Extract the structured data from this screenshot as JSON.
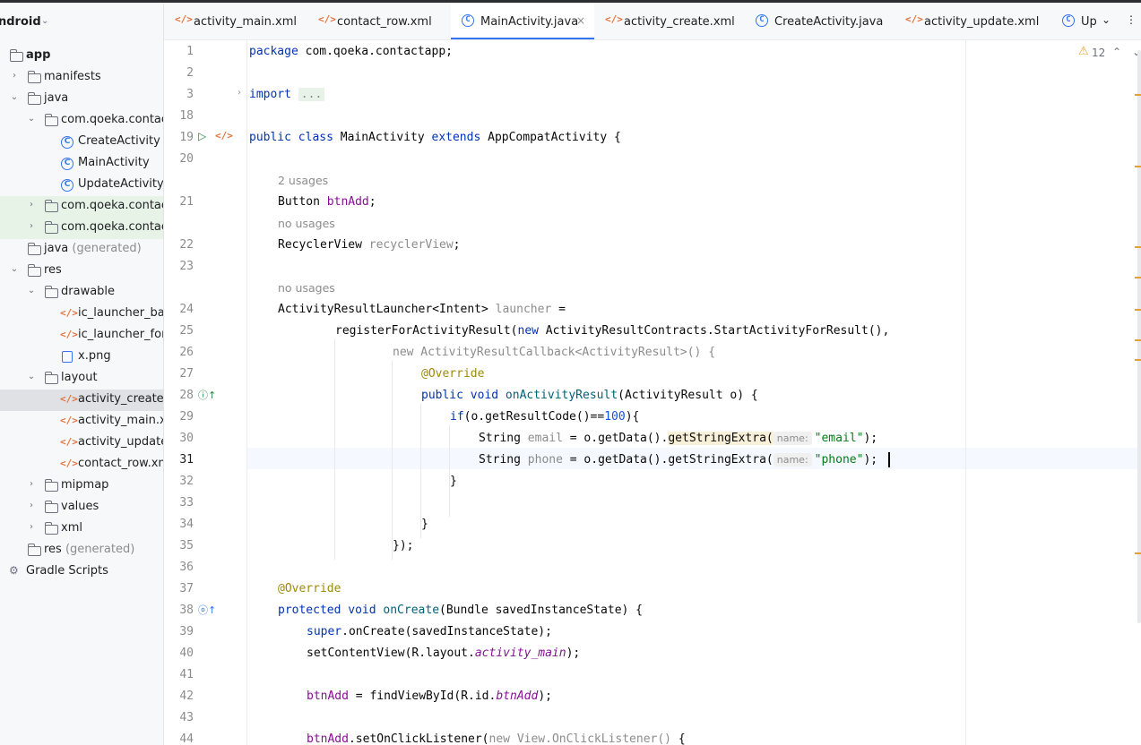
{
  "project": {
    "title": "ndroid",
    "tree": [
      {
        "label": "app",
        "bold": true,
        "icon": "folder-icon"
      },
      {
        "label": "manifests",
        "icon": "folder-icon"
      },
      {
        "label": "java",
        "icon": "folder-icon"
      },
      {
        "label": "com.qoeka.contacta",
        "icon": "package-icon"
      },
      {
        "label": "CreateActivity",
        "icon": "class-icon"
      },
      {
        "label": "MainActivity",
        "icon": "class-icon"
      },
      {
        "label": "UpdateActivity",
        "icon": "class-icon"
      },
      {
        "label": "com.qoeka.contacta",
        "icon": "package-icon"
      },
      {
        "label": "com.qoeka.contacta",
        "icon": "package-icon"
      },
      {
        "label": "java",
        "suffix": "(generated)",
        "icon": "folder-icon"
      },
      {
        "label": "res",
        "icon": "folder-icon"
      },
      {
        "label": "drawable",
        "icon": "folder-icon"
      },
      {
        "label": "ic_launcher_bacl",
        "icon": "xml-icon"
      },
      {
        "label": "ic_launcher_fore",
        "icon": "xml-icon"
      },
      {
        "label": "x.png",
        "icon": "image-icon"
      },
      {
        "label": "layout",
        "icon": "folder-icon"
      },
      {
        "label": "activity_create.xn",
        "icon": "xml-icon"
      },
      {
        "label": "activity_main.xml",
        "icon": "xml-icon"
      },
      {
        "label": "activity_update.x",
        "icon": "xml-icon"
      },
      {
        "label": "contact_row.xml",
        "icon": "xml-icon"
      },
      {
        "label": "mipmap",
        "icon": "folder-icon"
      },
      {
        "label": "values",
        "icon": "folder-icon"
      },
      {
        "label": "xml",
        "icon": "folder-icon"
      },
      {
        "label": "res",
        "suffix": "(generated)",
        "icon": "folder-icon"
      },
      {
        "label": "Gradle Scripts",
        "icon": "gradle-icon"
      }
    ]
  },
  "tabs": [
    {
      "label": "activity_main.xml",
      "icon": "xml"
    },
    {
      "label": "contact_row.xml",
      "icon": "xml"
    },
    {
      "label": "MainActivity.java",
      "icon": "class",
      "active": true
    },
    {
      "label": "activity_create.xml",
      "icon": "xml"
    },
    {
      "label": "CreateActivity.java",
      "icon": "class"
    },
    {
      "label": "activity_update.xml",
      "icon": "xml"
    },
    {
      "label": "Up",
      "icon": "class"
    }
  ],
  "inspection": {
    "warnings": "12"
  },
  "editor": {
    "current_line": "31",
    "line_numbers": [
      "1",
      "2",
      "3",
      "18",
      "19",
      "20",
      "21",
      "22",
      "23",
      "24",
      "25",
      "26",
      "27",
      "28",
      "29",
      "30",
      "31",
      "32",
      "33",
      "34",
      "35",
      "36",
      "37",
      "38",
      "39",
      "40",
      "41",
      "42",
      "43",
      "44"
    ],
    "hints": {
      "usages_2": "2 usages",
      "no_usages_a": "no usages",
      "no_usages_b": "no usages",
      "param_name": "name:"
    },
    "code": {
      "l1_kw": "package",
      "l1_rest": " com.qoeka.contactapp;",
      "l3_kw": "import",
      "l3_fold": "...",
      "l19_kw": "public class",
      "l19_name": " MainActivity ",
      "l19_ext": "extends",
      "l19_rest": " AppCompatActivity {",
      "l21_type": "Button ",
      "l21_field": "btnAdd",
      "l21_end": ";",
      "l22_type": "RecyclerView ",
      "l22_field": "recyclerView",
      "l22_end": ";",
      "l24_type": "ActivityResultLauncher<Intent> ",
      "l24_field": "launcher",
      "l24_end": " =",
      "l25_a": "registerForActivityResult(",
      "l25_new": "new",
      "l25_b": " ActivityResultContracts.StartActivityForResult(),",
      "l26": "new ActivityResultCallback<ActivityResult>() {",
      "l27": "@Override",
      "l28_kw": "public void",
      "l28_fn": " onActivityResult",
      "l28_rest": "(ActivityResult o) {",
      "l29_kw": "if",
      "l29_a": "(o.getResultCode()==",
      "l29_num": "100",
      "l29_b": "){",
      "l30_type": "String ",
      "l30_var": "email",
      "l30_mid": " = o.getData().",
      "l30_call": "getStringExtra(",
      "l30_str": "\"email\"",
      "l30_end": ");",
      "l31_type": "String ",
      "l31_var": "phone",
      "l31_mid": " = o.getData().getStringExtra(",
      "l31_str": "\"phone\"",
      "l31_end": ");",
      "l32": "}",
      "l34": "}",
      "l35": "});",
      "l37": "@Override",
      "l38_kw": "protected void",
      "l38_fn": " onCreate",
      "l38_rest": "(Bundle savedInstanceState) {",
      "l39_kw": "super",
      "l39_rest": ".onCreate(savedInstanceState);",
      "l40_a": "setContentView(R.layout.",
      "l40_it": "activity_main",
      "l40_b": ");",
      "l42_fld": "btnAdd",
      "l42_a": " = findViewById(R.id.",
      "l42_it": "btnAdd",
      "l42_b": ");",
      "l44_fld": "btnAdd",
      "l44_a": ".setOnClickListener(",
      "l44_new": "new View.OnClickListener()",
      "l44_b": " {"
    }
  }
}
